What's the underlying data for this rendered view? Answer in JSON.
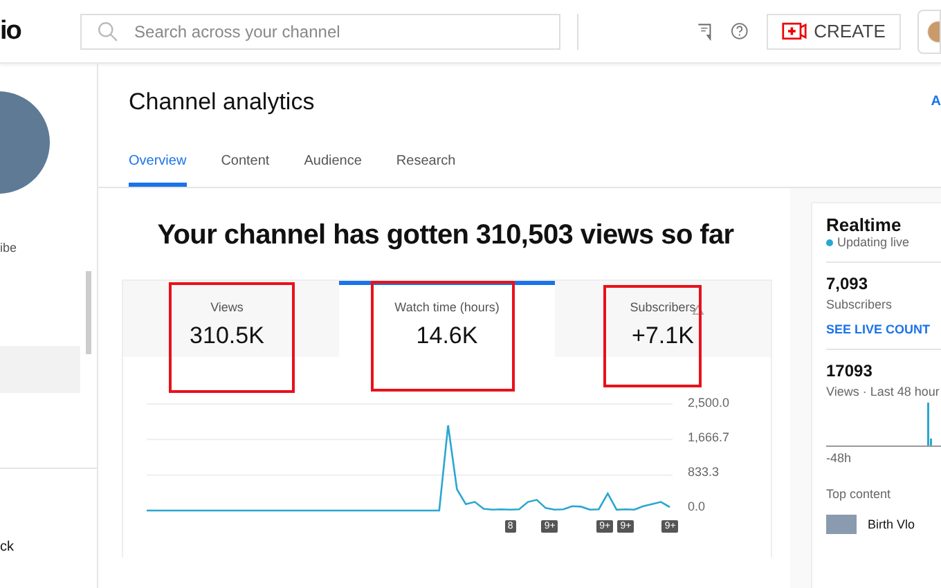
{
  "header": {
    "logo_text": "io",
    "search": {
      "placeholder": "Search across your channel"
    },
    "create_label": "CREATE"
  },
  "sidebar": {
    "channel_label": "ibe",
    "items": [
      {
        "selected": true
      },
      {
        "label": "ck",
        "selected": false
      }
    ]
  },
  "page": {
    "title": "Channel analytics",
    "top_link": "A",
    "tabs": [
      {
        "label": "Overview",
        "selected": true
      },
      {
        "label": "Content",
        "selected": false
      },
      {
        "label": "Audience",
        "selected": false
      },
      {
        "label": "Research",
        "selected": false
      }
    ]
  },
  "headline": "Your channel has gotten 310,503 views so far",
  "metrics": [
    {
      "label": "Views",
      "value": "310.5K",
      "selected": false,
      "highlighted": true,
      "warning": false
    },
    {
      "label": "Watch time (hours)",
      "value": "14.6K",
      "selected": true,
      "highlighted": true,
      "warning": false
    },
    {
      "label": "Subscribers",
      "value": "+7.1K",
      "selected": false,
      "highlighted": true,
      "warning": true
    }
  ],
  "chart": {
    "chart_data": {
      "type": "line",
      "ylim": [
        0,
        2500
      ],
      "yticks": [
        {
          "value": 2500,
          "label": "2,500.0"
        },
        {
          "value": 1666.7,
          "label": "1,666.7"
        },
        {
          "value": 833.3,
          "label": "833.3"
        },
        {
          "value": 0,
          "label": "0.0"
        }
      ],
      "series": [
        {
          "color": "#2aa7d0",
          "values": [
            0,
            0,
            0,
            0,
            0,
            0,
            0,
            0,
            0,
            0,
            0,
            0,
            0,
            0,
            0,
            0,
            0,
            0,
            0,
            0,
            0,
            0,
            0,
            0,
            0,
            0,
            0,
            0,
            0,
            0,
            0,
            0,
            0,
            0,
            2000,
            500,
            150,
            200,
            40,
            20,
            30,
            20,
            30,
            200,
            250,
            60,
            20,
            30,
            100,
            90,
            20,
            30,
            400,
            20,
            30,
            20,
            100,
            150,
            200,
            80
          ]
        }
      ]
    },
    "markers": [
      "8",
      "9+",
      "9+",
      "9+",
      "9+"
    ]
  },
  "realtime": {
    "title": "Realtime",
    "status": "Updating live",
    "subscribers_count": "7,093",
    "subscribers_label": "Subscribers",
    "live_count_link": "SEE LIVE COUNT",
    "views_count": "17093",
    "views_label": "Views · Last 48 hour",
    "axis_label": "-48h",
    "top_content_label": "Top content",
    "top_video_title": "Birth Vlo"
  }
}
